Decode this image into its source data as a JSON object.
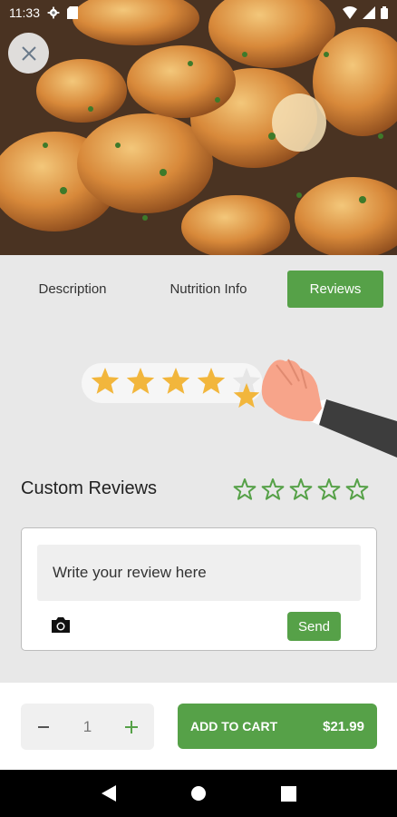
{
  "status_bar": {
    "time": "11:33"
  },
  "tabs": [
    {
      "label": "Description",
      "active": false
    },
    {
      "label": "Nutrition Info",
      "active": false
    },
    {
      "label": "Reviews",
      "active": true
    }
  ],
  "illustration": {
    "rating_shown": 4,
    "rating_max": 5
  },
  "reviews": {
    "title": "Custom Reviews",
    "user_rating": 0,
    "user_rating_max": 5,
    "placeholder": "Write your review here",
    "send_label": "Send"
  },
  "cart": {
    "quantity": "1",
    "add_label": "ADD TO CART",
    "price": "$21.99"
  },
  "colors": {
    "accent": "#56a148",
    "star": "#f2b63c"
  }
}
